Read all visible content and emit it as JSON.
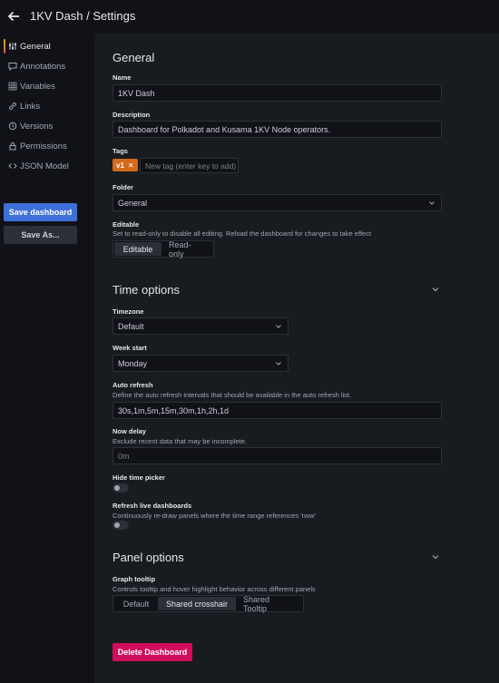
{
  "header": {
    "title": "1KV Dash / Settings"
  },
  "sidebar": {
    "items": [
      {
        "label": "General",
        "icon": "sliders-icon"
      },
      {
        "label": "Annotations",
        "icon": "comment-icon"
      },
      {
        "label": "Variables",
        "icon": "grid-icon"
      },
      {
        "label": "Links",
        "icon": "link-icon"
      },
      {
        "label": "Versions",
        "icon": "history-icon"
      },
      {
        "label": "Permissions",
        "icon": "lock-icon"
      },
      {
        "label": "JSON Model",
        "icon": "code-icon"
      }
    ],
    "save_label": "Save dashboard",
    "save_as_label": "Save As..."
  },
  "general": {
    "heading": "General",
    "name_label": "Name",
    "name_value": "1KV Dash",
    "description_label": "Description",
    "description_value": "Dashboard for Polkadot and Kusama 1KV Node operators.",
    "tags_label": "Tags",
    "tag": "v1",
    "tag_placeholder": "New tag (enter key to add)",
    "folder_label": "Folder",
    "folder_value": "General",
    "editable_label": "Editable",
    "editable_desc": "Set to read-only to disable all editing. Reload the dashboard for changes to take effect",
    "editable_options": [
      "Editable",
      "Read-only"
    ]
  },
  "time_options": {
    "heading": "Time options",
    "timezone_label": "Timezone",
    "timezone_value": "Default",
    "week_start_label": "Week start",
    "week_start_value": "Monday",
    "auto_refresh_label": "Auto refresh",
    "auto_refresh_desc": "Define the auto refresh intervals that should be available in the auto refresh list.",
    "auto_refresh_value": "30s,1m,5m,15m,30m,1h,2h,1d",
    "now_delay_label": "Now delay",
    "now_delay_desc": "Exclude recent data that may be incomplete.",
    "now_delay_placeholder": "0m",
    "hide_picker_label": "Hide time picker",
    "refresh_live_label": "Refresh live dashboards",
    "refresh_live_desc": "Continuously re-draw panels where the time range references 'now'"
  },
  "panel_options": {
    "heading": "Panel options",
    "graph_tooltip_label": "Graph tooltip",
    "graph_tooltip_desc": "Controls tooltip and hover highlight behavior across different panels",
    "tooltip_options": [
      "Default",
      "Shared crosshair",
      "Shared Tooltip"
    ]
  },
  "delete_label": "Delete Dashboard",
  "colors": {
    "primary": "#3d71d9",
    "danger": "#d10e5c",
    "tag": "#d3691c",
    "background": "#111217",
    "panel": "#181b1f"
  }
}
